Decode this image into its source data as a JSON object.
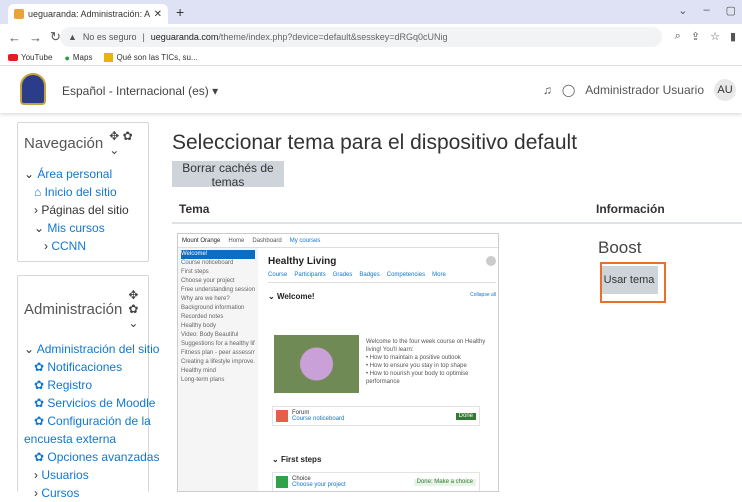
{
  "browser": {
    "tab_title": "ueguaranda: Administración: Apa",
    "new_tab": "+",
    "url_warning": "No es seguro",
    "url_host": "ueguaranda.com",
    "url_path": "/theme/index.php?device=default&sesskey=dRGq0cUNig",
    "bookmarks": [
      "YouTube",
      "Maps",
      "Qué son las TICs, su..."
    ]
  },
  "header": {
    "language": "Español - Internacional (es) ▾",
    "user_name": "Administrador Usuario",
    "avatar": "AU"
  },
  "nav_block": {
    "title": "Navegación",
    "items": [
      "Área personal",
      "Inicio del sitio",
      "Páginas del sitio",
      "Mis cursos",
      "CCNN"
    ]
  },
  "admin_block": {
    "title": "Administración",
    "items": [
      "Administración del sitio",
      "Notificaciones",
      "Registro",
      "Servicios de Moodle",
      "Configuración de la",
      "encuesta externa",
      "Opciones avanzadas",
      "Usuarios",
      "Cursos"
    ]
  },
  "main": {
    "title": "Seleccionar tema para el dispositivo default",
    "purge_button": "Borrar cachés de temas",
    "col_theme": "Tema",
    "col_info": "Información",
    "theme_name": "Boost",
    "use_button": "Usar tema"
  },
  "preview": {
    "site": "Mount Orange",
    "nav": [
      "Home",
      "Dashboard",
      "My courses"
    ],
    "course": "Healthy Living",
    "tabs": [
      "Course",
      "Participants",
      "Grades",
      "Badges",
      "Competencies",
      "More"
    ],
    "sidebar": [
      "Welcome!",
      "Course noticeboard",
      "First steps",
      "Choose your project",
      "Free understanding session",
      "Why are we here?",
      "Background information",
      "Recorded notes",
      "Healthy body",
      "Video: Body Beautiful",
      "Suggestions for a healthy life",
      "Fitness plan - peer assessment",
      "Creating a lifestyle improve...",
      "Healthy mind",
      "Long-term plans"
    ],
    "section1": "Welcome!",
    "collapse": "Collapse all",
    "bullets": [
      "Welcome to the four week course on Healthy living! You'll learn:",
      "How to maintain a positive outlook",
      "How to ensure you stay in top shape",
      "How to nourish your body to optimise performance"
    ],
    "act1_name": "Forum",
    "act1_sub": "Course noticeboard",
    "act1_badge": "Done",
    "section2": "First steps",
    "act2_name": "Choice",
    "act2_sub": "Choose your project",
    "act2_badge": "Done: Make a choice"
  }
}
